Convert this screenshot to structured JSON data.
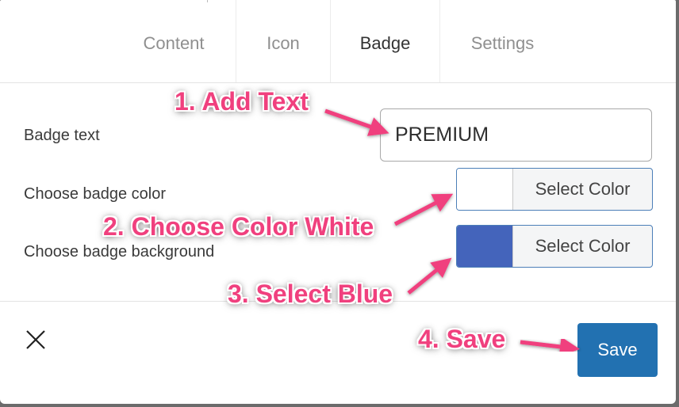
{
  "tabs": [
    {
      "label": "Content",
      "active": false
    },
    {
      "label": "Icon",
      "active": false
    },
    {
      "label": "Badge",
      "active": true
    },
    {
      "label": "Settings",
      "active": false
    }
  ],
  "fields": {
    "badge_text": {
      "label": "Badge text",
      "value": "PREMIUM"
    },
    "badge_color": {
      "label": "Choose badge color",
      "button_label": "Select Color",
      "swatch_color": "#ffffff"
    },
    "badge_background": {
      "label": "Choose badge background",
      "button_label": "Select Color",
      "swatch_color": "#4464bb"
    }
  },
  "footer": {
    "close_icon": "close-icon",
    "save_label": "Save"
  },
  "annotations": {
    "step1": "1. Add Text",
    "step2": "2. Choose Color White",
    "step3": "3. Select Blue",
    "step4": "4. Save"
  },
  "colors": {
    "accent": "#2271b1",
    "annotation": "#f0407e",
    "picker_border": "#4c7fb8"
  }
}
